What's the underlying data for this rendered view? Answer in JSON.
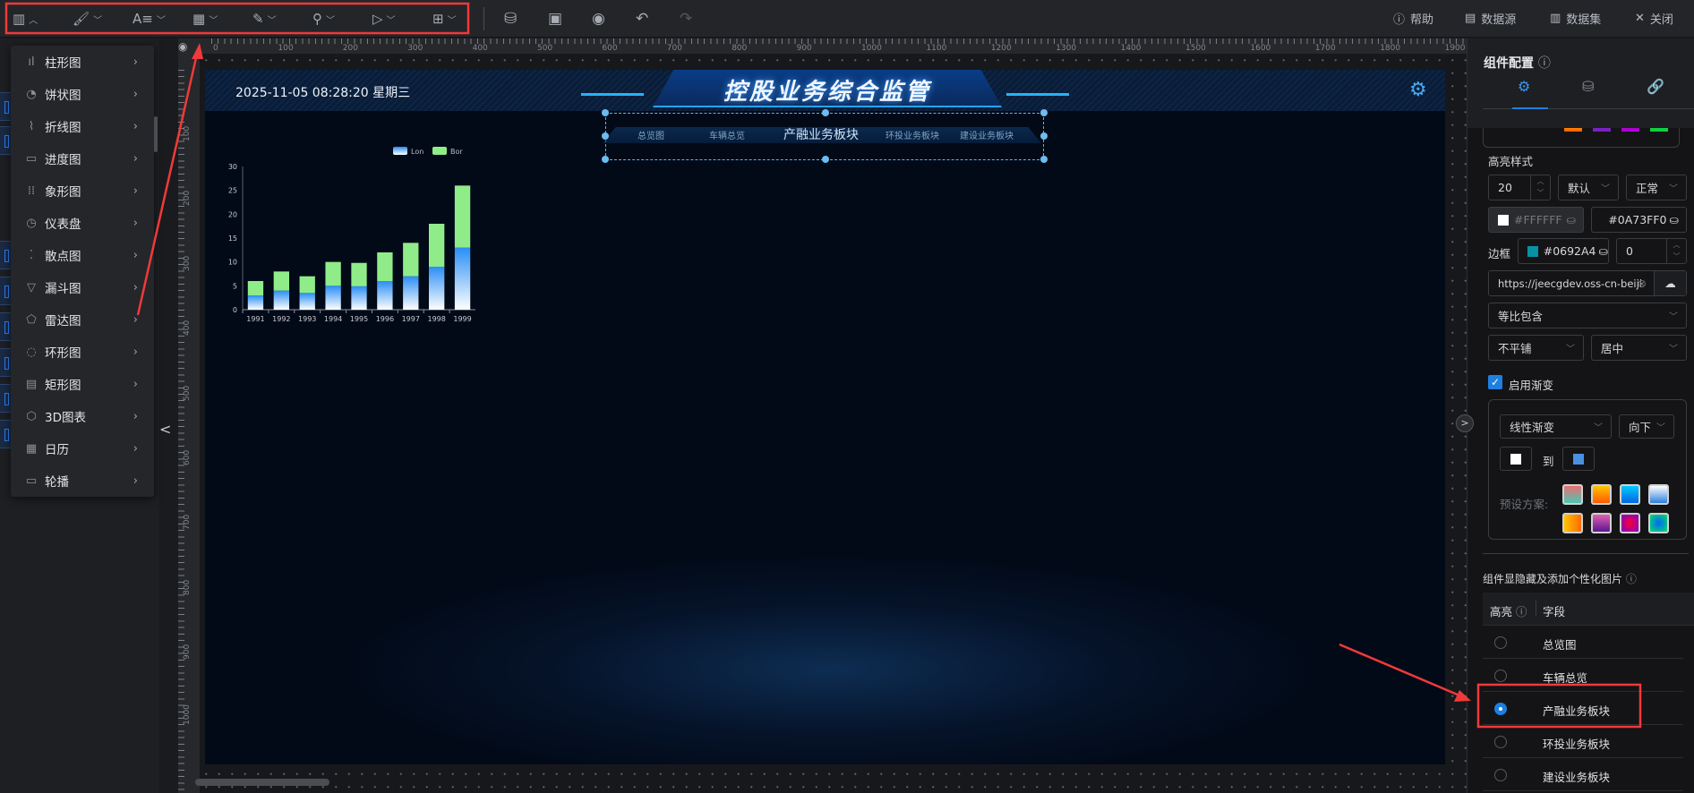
{
  "toolbar": {
    "tools": [
      {
        "icon": "bar-chart-icon",
        "g": "▥"
      },
      {
        "icon": "paint-roller-icon",
        "g": "🖌"
      },
      {
        "icon": "text-icon",
        "g": "A≡"
      },
      {
        "icon": "table-icon",
        "g": "▦"
      },
      {
        "icon": "edit-icon",
        "g": "✎"
      },
      {
        "icon": "map-pin-icon",
        "g": "⚲"
      },
      {
        "icon": "play-icon",
        "g": "▷"
      },
      {
        "icon": "grid-icon",
        "g": "⊞"
      }
    ],
    "actions": [
      {
        "icon": "database-icon",
        "g": "⛁"
      },
      {
        "icon": "save-icon",
        "g": "▣"
      },
      {
        "icon": "preview-eye-icon",
        "g": "◉"
      },
      {
        "icon": "undo-icon",
        "g": "↶"
      },
      {
        "icon": "redo-icon",
        "g": "↷"
      }
    ],
    "help": "帮助",
    "datasource": "数据源",
    "dataset": "数据集",
    "close": "关闭"
  },
  "menu": [
    {
      "label": "柱形图",
      "g": "ıl"
    },
    {
      "label": "饼状图",
      "g": "◔"
    },
    {
      "label": "折线图",
      "g": "⌇"
    },
    {
      "label": "进度图",
      "g": "▭"
    },
    {
      "label": "象形图",
      "g": "⁞⁞"
    },
    {
      "label": "仪表盘",
      "g": "◷"
    },
    {
      "label": "散点图",
      "g": "⁚"
    },
    {
      "label": "漏斗图",
      "g": "▽"
    },
    {
      "label": "雷达图",
      "g": "⬠"
    },
    {
      "label": "环形图",
      "g": "◌"
    },
    {
      "label": "矩形图",
      "g": "▤"
    },
    {
      "label": "3D图表",
      "g": "⬡"
    },
    {
      "label": "日历",
      "g": "▦"
    },
    {
      "label": "轮播",
      "g": "▭"
    }
  ],
  "ruler": {
    "h": [
      "0",
      "100",
      "200",
      "300",
      "400",
      "500",
      "600",
      "700",
      "800",
      "900",
      "1000",
      "1100",
      "1200",
      "1300",
      "1400",
      "1500",
      "1600",
      "1700",
      "1800",
      "1900"
    ],
    "v": [
      "100",
      "200",
      "300",
      "400",
      "500",
      "600",
      "700",
      "800",
      "900",
      "1000"
    ]
  },
  "canvas": {
    "datetime": "2025-11-05 08:28:20  星期三",
    "title": "控股业务综合监管",
    "tabs": [
      "总览图",
      "车辆总览",
      "产融业务板块",
      "环投业务板块",
      "建设业务板块"
    ],
    "active_tab": 2
  },
  "chart_data": {
    "type": "bar",
    "stacked": true,
    "categories": [
      "1991",
      "1992",
      "1993",
      "1994",
      "1995",
      "1996",
      "1997",
      "1998",
      "1999"
    ],
    "series": [
      {
        "name": "Lon",
        "values": [
          3,
          4,
          3.5,
          5,
          4.9,
          6,
          7,
          9,
          13
        ],
        "color": "#2a8ef5"
      },
      {
        "name": "Bor",
        "values": [
          3,
          4,
          3.5,
          5,
          4.9,
          6,
          7,
          9,
          13
        ],
        "color": "#90ec88"
      }
    ],
    "ylim": [
      0,
      30
    ],
    "yticks": [
      "0",
      "5",
      "10",
      "15",
      "20",
      "25",
      "30"
    ],
    "legend": "top-right"
  },
  "panel": {
    "title": "组件配置",
    "highlight_style": "高亮样式",
    "font_size": "20",
    "font_family": "默认",
    "font_weight": "正常",
    "color1": "#FFFFFF",
    "color2": "#0A73FF0",
    "border_label": "边框",
    "border_color": "#0692A4",
    "border_width": "0",
    "image_url": "https://jeecgdev.oss-cn-beiji",
    "fit": "等比包含",
    "repeat": "不平铺",
    "align": "居中",
    "gradient_enabled": "启用渐变",
    "gradient_type": "线性渐变",
    "gradient_dir": "向下",
    "to": "到",
    "preset_label": "预设方案:",
    "presets": [
      "linear-gradient(#e97070,#4cc7b6)",
      "linear-gradient(#ffc400,#ff5a00)",
      "linear-gradient(#00c8ff,#0066e0)",
      "linear-gradient(#ffffff,#2e7fdc)",
      "linear-gradient(90deg,#ffc400,#ff6a00)",
      "linear-gradient(#e060b0,#5a1790)",
      "radial-gradient(#ff0030,#7a00d0)",
      "radial-gradient(#0066ff,#00e060)"
    ],
    "section": "组件显隐藏及添加个性化图片",
    "col_highlight": "高亮",
    "col_field": "字段",
    "rows": [
      "总览图",
      "车辆总览",
      "产融业务板块",
      "环投业务板块",
      "建设业务板块"
    ],
    "selected_row": 2
  },
  "colors": {
    "accent": "#1f7fe0",
    "annotation": "#f03a3a"
  }
}
